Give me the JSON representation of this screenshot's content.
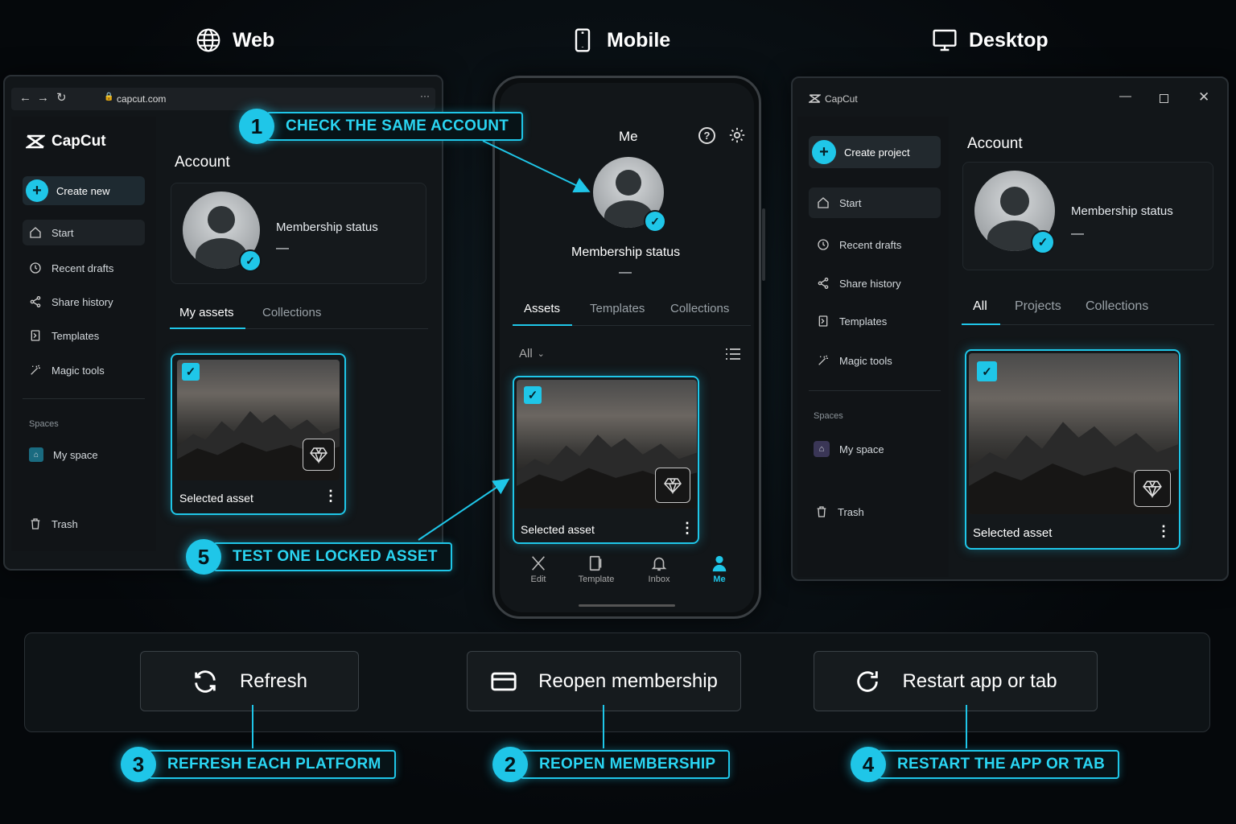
{
  "platforms": {
    "web": "Web",
    "mobile": "Mobile",
    "desktop": "Desktop"
  },
  "colors": {
    "accent": "#1fc6e8",
    "background": "#05080b",
    "panel": "#121619"
  },
  "web": {
    "url": "capcut.com",
    "brand": "CapCut",
    "create_label": "Create new",
    "nav": [
      "Start",
      "Recent drafts",
      "Share history",
      "Templates",
      "Magic tools"
    ],
    "spaces_heading": "Spaces",
    "space_item": "My space",
    "trash": "Trash",
    "account_title": "Account",
    "membership_label": "Membership status",
    "membership_value": "—",
    "tabs": [
      "My assets",
      "Collections"
    ],
    "asset_label": "Selected asset"
  },
  "mobile": {
    "header_title": "Me",
    "membership_label": "Membership status",
    "membership_value": "—",
    "tabs": [
      "Assets",
      "Templates",
      "Collections"
    ],
    "filter": "All",
    "asset_label": "Selected asset",
    "bottom_nav": [
      "Edit",
      "Template",
      "Inbox",
      "Me"
    ]
  },
  "desktop": {
    "window_title": "CapCut",
    "create_label": "Create project",
    "nav": [
      "Start",
      "Recent drafts",
      "Share history",
      "Templates",
      "Magic tools"
    ],
    "spaces_heading": "Spaces",
    "space_item": "My space",
    "trash": "Trash",
    "account_title": "Account",
    "membership_label": "Membership status",
    "membership_value": "—",
    "tabs": [
      "All",
      "Projects",
      "Collections"
    ],
    "asset_label": "Selected asset"
  },
  "actions": {
    "refresh": "Refresh",
    "reopen": "Reopen membership",
    "restart": "Restart app or tab"
  },
  "callouts": [
    {
      "num": "1",
      "text": "CHECK THE SAME ACCOUNT"
    },
    {
      "num": "2",
      "text": "REOPEN MEMBERSHIP"
    },
    {
      "num": "3",
      "text": "REFRESH EACH PLATFORM"
    },
    {
      "num": "4",
      "text": "RESTART THE APP OR TAB"
    },
    {
      "num": "5",
      "text": "TEST ONE LOCKED ASSET"
    }
  ]
}
